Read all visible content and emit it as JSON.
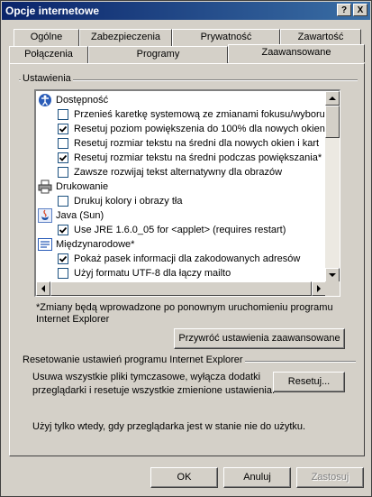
{
  "window": {
    "title": "Opcje internetowe",
    "help_label": "?",
    "close_label": "X"
  },
  "tabs_row1": [
    "Ogólne",
    "Zabezpieczenia",
    "Prywatność",
    "Zawartość"
  ],
  "tabs_row2": [
    "Połączenia",
    "Programy",
    "Zaawansowane"
  ],
  "settings_group": {
    "label": "Ustawienia",
    "items": [
      {
        "type": "category",
        "icon": "accessibility-icon",
        "label": "Dostępność"
      },
      {
        "type": "checkbox",
        "checked": false,
        "label": "Przenieś karetkę systemową ze zmianami fokusu/wyboru"
      },
      {
        "type": "checkbox",
        "checked": true,
        "label": "Resetuj poziom powiększenia do 100% dla nowych okien i"
      },
      {
        "type": "checkbox",
        "checked": false,
        "label": "Resetuj rozmiar tekstu na średni dla nowych okien i kart"
      },
      {
        "type": "checkbox",
        "checked": true,
        "label": "Resetuj rozmiar tekstu na średni podczas powiększania*"
      },
      {
        "type": "checkbox",
        "checked": false,
        "label": "Zawsze rozwijaj tekst alternatywny dla obrazów"
      },
      {
        "type": "category",
        "icon": "printer-icon",
        "label": "Drukowanie"
      },
      {
        "type": "checkbox",
        "checked": false,
        "label": "Drukuj kolory i obrazy tła"
      },
      {
        "type": "category",
        "icon": "java-icon",
        "label": "Java (Sun)"
      },
      {
        "type": "checkbox",
        "checked": true,
        "label": "Use JRE 1.6.0_05 for <applet> (requires restart)"
      },
      {
        "type": "category",
        "icon": "international-icon",
        "label": "Międzynarodowe*"
      },
      {
        "type": "checkbox",
        "checked": true,
        "label": "Pokaż pasek informacji dla zakodowanych adresów"
      },
      {
        "type": "checkbox",
        "checked": false,
        "label": "Użyj formatu UTF-8 dla łączy mailto"
      }
    ],
    "note_line1": "*Zmiany będą wprowadzone po ponownym uruchomieniu programu",
    "note_line2": "Internet Explorer",
    "restore_button": "Przywróć ustawienia zaawansowane"
  },
  "reset_group": {
    "label": "Resetowanie ustawień programu Internet Explorer",
    "desc_line1": "Usuwa wszystkie pliki tymczasowe, wyłącza dodatki",
    "desc_line2": "przeglądarki i resetuje wszystkie zmienione ustawienia.",
    "reset_button": "Resetuj...",
    "warning": "Użyj tylko wtedy, gdy przeglądarka jest w stanie nie do użytku."
  },
  "footer": {
    "ok": "OK",
    "cancel": "Anuluj",
    "apply": "Zastosuj"
  }
}
